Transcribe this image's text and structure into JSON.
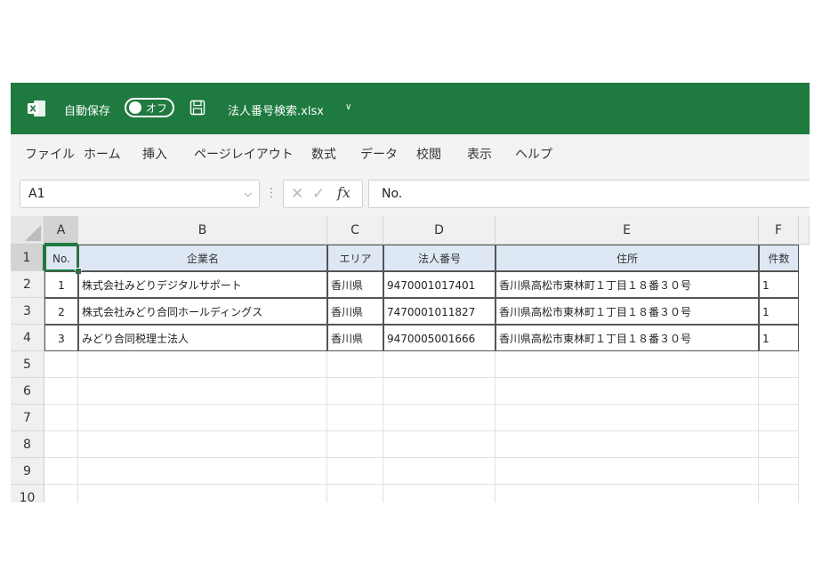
{
  "titlebar": {
    "logo_text": "X",
    "autosave_label": "自動保存",
    "autosave_state": "オフ",
    "filename": "法人番号検索.xlsx"
  },
  "tabs": [
    "ファイル",
    "ホーム",
    "挿入",
    "ページレイアウト",
    "数式",
    "データ",
    "校閲",
    "表示",
    "ヘルプ"
  ],
  "formula_bar": {
    "name_box": "A1",
    "formula": "No."
  },
  "grid": {
    "columns": [
      "A",
      "B",
      "C",
      "D",
      "E",
      "F"
    ],
    "rows": [
      "1",
      "2",
      "3",
      "4",
      "5",
      "6",
      "7",
      "8",
      "9",
      "10"
    ],
    "header": [
      "No.",
      "企業名",
      "エリア",
      "法人番号",
      "住所",
      "件数"
    ],
    "data": [
      [
        "1",
        "株式会社みどりデジタルサポート",
        "香川県",
        "9470001017401",
        "香川県高松市東林町１丁目１８番３０号",
        "1"
      ],
      [
        "2",
        "株式会社みどり合同ホールディングス",
        "香川県",
        "7470001011827",
        "香川県高松市東林町１丁目１８番３０号",
        "1"
      ],
      [
        "3",
        "みどり合同税理士法人",
        "香川県",
        "9470005001666",
        "香川県高松市東林町１丁目１８番３０号",
        "1"
      ]
    ]
  }
}
